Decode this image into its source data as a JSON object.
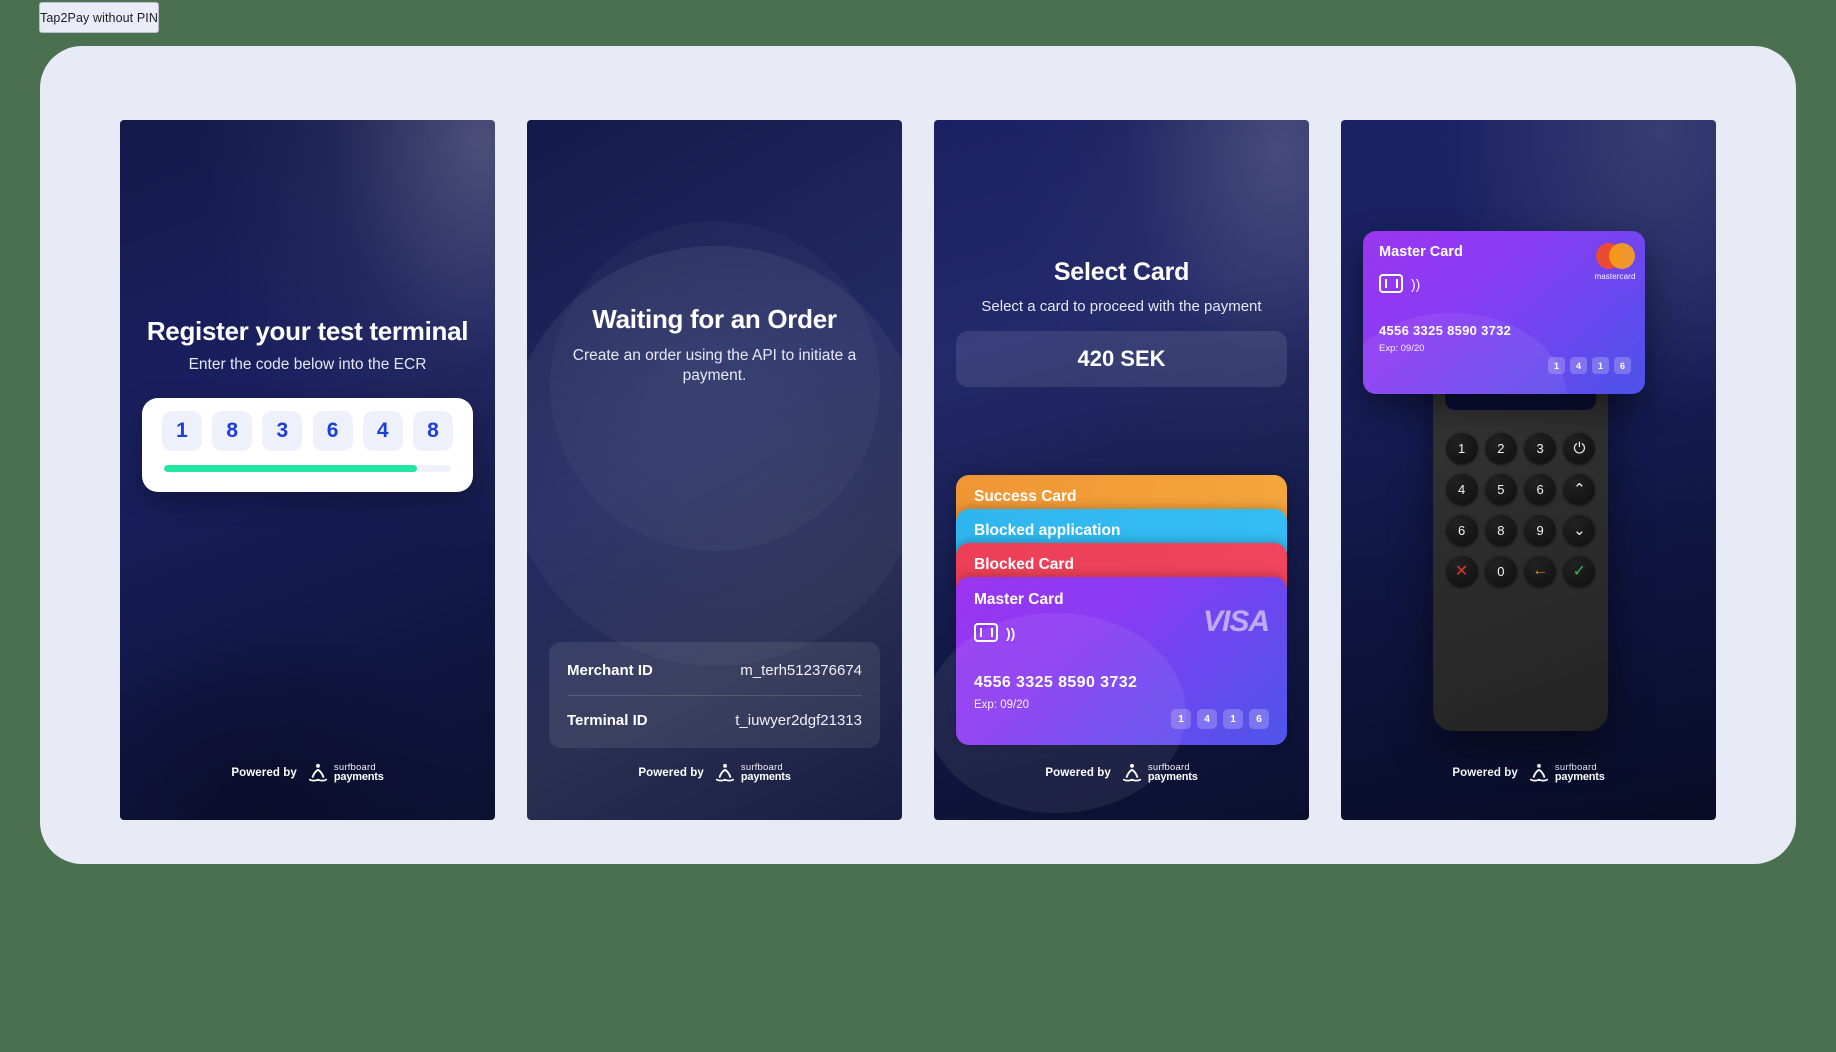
{
  "window": {
    "tab_label": "Tap2Pay without PIN"
  },
  "colors": {
    "background": "#4a7050",
    "stage": "#e8eaf6",
    "accent_green": "#23e6a0",
    "digit_blue": "#1d3fd6",
    "success_card": "#ef9634",
    "blocked_application": "#2fb6ee",
    "blocked_card": "#ec3f57",
    "master_card": "#8a3bf3"
  },
  "panels": [
    {
      "id": "register-terminal",
      "title": "Register your test terminal",
      "subtitle": "Enter the code below into the ECR",
      "code_digits": [
        "1",
        "8",
        "3",
        "6",
        "4",
        "8"
      ],
      "progress_percent": 88
    },
    {
      "id": "waiting-for-order",
      "title": "Waiting for an Order",
      "subtitle": "Create an order using the API to initiate a payment.",
      "details": [
        {
          "label": "Merchant ID",
          "value": "m_terh512376674"
        },
        {
          "label": "Terminal ID",
          "value": "t_iuwyer2dgf21313"
        }
      ]
    },
    {
      "id": "select-card",
      "title": "Select Card",
      "subtitle": "Select a card to proceed with the payment",
      "amount": "420 SEK",
      "cards": [
        {
          "name": "Success Card",
          "color": "#ef9634"
        },
        {
          "name": "Blocked application",
          "color": "#2fb6ee"
        },
        {
          "name": "Blocked Card",
          "color": "#ec3f57"
        },
        {
          "name": "Master Card",
          "color": "#8a3bf3",
          "brand": "VISA",
          "number": "4556 3325 8590 3732",
          "expiry": "Exp: 09/20",
          "pin": [
            "1",
            "4",
            "1",
            "6"
          ]
        }
      ]
    },
    {
      "id": "terminal-pin-entry",
      "card": {
        "name": "Master Card",
        "brand": "mastercard",
        "number": "4556 3325 8590 3732",
        "expiry": "Exp: 09/20",
        "pin": [
          "1",
          "4",
          "1",
          "6"
        ]
      },
      "keypad": [
        {
          "label": "1",
          "kind": "digit"
        },
        {
          "label": "2",
          "kind": "digit"
        },
        {
          "label": "3",
          "kind": "digit"
        },
        {
          "label": "⏻",
          "kind": "power"
        },
        {
          "label": "4",
          "kind": "digit"
        },
        {
          "label": "5",
          "kind": "digit"
        },
        {
          "label": "6",
          "kind": "digit"
        },
        {
          "label": "⌃",
          "kind": "up"
        },
        {
          "label": "6",
          "kind": "digit"
        },
        {
          "label": "8",
          "kind": "digit"
        },
        {
          "label": "9",
          "kind": "digit"
        },
        {
          "label": "⌄",
          "kind": "down"
        },
        {
          "label": "✕",
          "kind": "cancel"
        },
        {
          "label": "0",
          "kind": "digit"
        },
        {
          "label": "←",
          "kind": "back"
        },
        {
          "label": "✓",
          "kind": "confirm"
        }
      ]
    }
  ],
  "footer": {
    "powered_by": "Powered by",
    "brand_top": "surfboard",
    "brand_bottom": "payments"
  }
}
